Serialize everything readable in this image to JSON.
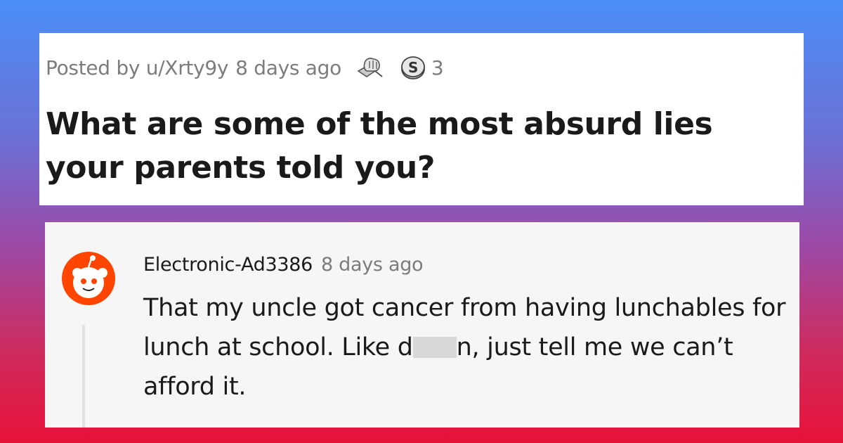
{
  "post": {
    "posted_by": "Posted by u/Xrty9y",
    "time": "8 days ago",
    "awards": [
      {
        "icon": "fist-bump-award-icon"
      },
      {
        "icon": "silver-coin-award-icon",
        "count": "3"
      }
    ],
    "title": "What are some of the most absurd lies your parents told you?"
  },
  "comment": {
    "author": "Electronic-Ad3386",
    "time": "8 days ago",
    "avatar": "reddit-snoo-avatar-icon",
    "body_part1": "That my uncle got cancer from having lunchables for lunch at school. Like d",
    "body_part2": "n, just tell me we can’t afford it."
  },
  "colors": {
    "gradient_top": "#4a8ef7",
    "gradient_bottom": "#e8123a",
    "avatar_orange": "#ff4500",
    "meta_gray": "#7c7c7c",
    "text_dark": "#1a1a1b"
  }
}
